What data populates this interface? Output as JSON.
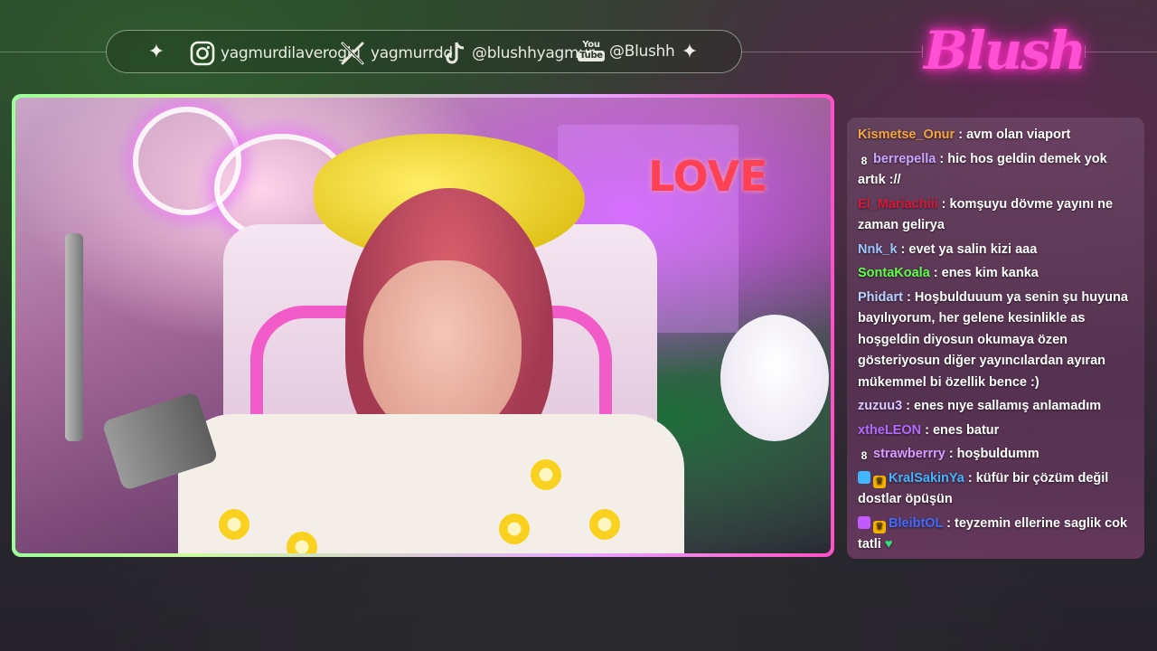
{
  "social": {
    "instagram": {
      "icon": "instagram-icon",
      "handle": "yagmurdilaveroglu"
    },
    "x": {
      "icon": "x-icon",
      "handle": "yagmurrdd"
    },
    "tiktok": {
      "icon": "tiktok-icon",
      "handle": "@blushhyagmur"
    },
    "youtube": {
      "icon": "youtube-icon",
      "line1": "You",
      "line2": "Tube",
      "handle": "@Blushh"
    },
    "sparkle": "✦"
  },
  "brand": {
    "logo_text": "Blush"
  },
  "scene": {
    "love_text": "LOVE"
  },
  "chat": {
    "messages": [
      {
        "user": "Kismetse_Onur",
        "color": "#f4a63a",
        "badges": [],
        "text": " : avm olan viaport"
      },
      {
        "user": "berrepella",
        "color": "#c6a6ff",
        "badges": [
          "hash"
        ],
        "text": " : hic hos geldin demek yok artık ://"
      },
      {
        "user": "El_Mariachiii",
        "color": "#d6193a",
        "badges": [],
        "text": " : komşuyu dövme yayını ne zaman gelirya"
      },
      {
        "user": "Nnk_k",
        "color": "#9cc7ff",
        "badges": [],
        "text": " : evet ya salin kizi aaa"
      },
      {
        "user": "SontaKoala",
        "color": "#5dff4a",
        "badges": [],
        "text": " : enes kim kanka"
      },
      {
        "user": "Phidart",
        "color": "#b9d2ff",
        "badges": [],
        "text": " : Hoşbulduuum ya senin şu huyuna bayılıyorum, her gelene kesinlikle as hoşgeldin diyosun okumaya özen gösteriyosun diğer yayıncılardan ayıran mükemmel bi özellik bence :)"
      },
      {
        "user": "zuzuu3",
        "color": "#d8c8ff",
        "badges": [],
        "text": " : enes nıye sallamış anlamadım"
      },
      {
        "user": "xtheLEON",
        "color": "#b36bff",
        "badges": [],
        "text": " : enes batur"
      },
      {
        "user": "strawberrry",
        "color": "#d89cff",
        "badges": [
          "hash"
        ],
        "text": " : hoşbuldumm"
      },
      {
        "user": "KralSakinYa",
        "color": "#3fb6ff",
        "badges": [
          "cube",
          "crown"
        ],
        "text": " : küfür bir çözüm değil dostlar öpüşün"
      },
      {
        "user": "BleibtOL",
        "color": "#3f6bff",
        "badges": [
          "gem",
          "crown"
        ],
        "text": " : teyzemin ellerine saglik cok tatli ",
        "emote": "♥"
      }
    ]
  },
  "colors": {
    "brand_pink": "#ff4fd2",
    "frame_green": "#9cff9a",
    "frame_pink": "#ff4fc8"
  }
}
